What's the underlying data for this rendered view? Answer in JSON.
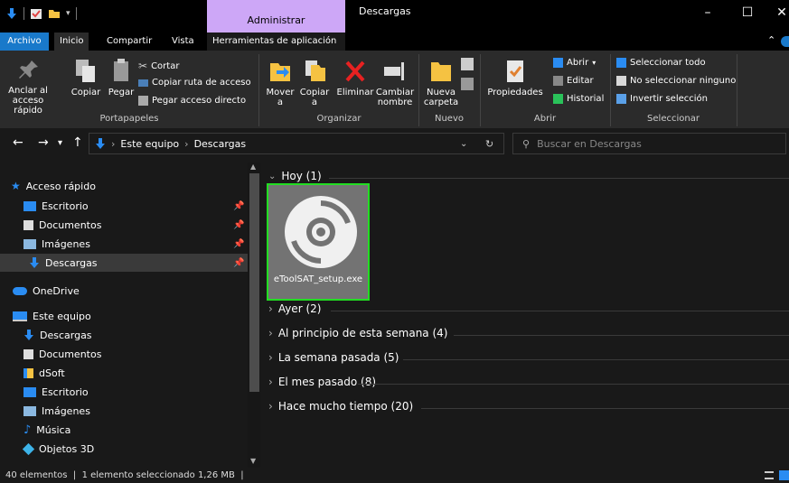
{
  "window": {
    "title": "Descargas",
    "contextual_tab": "Administrar"
  },
  "tabs": [
    "Archivo",
    "Inicio",
    "Compartir",
    "Vista",
    "Herramientas de aplicación"
  ],
  "ribbon": {
    "portapapeles": {
      "label": "Portapapeles",
      "anclar": "Anclar al\nacceso rápido",
      "copiar": "Copiar",
      "pegar": "Pegar",
      "cortar": "Cortar",
      "copiar_ruta": "Copiar ruta de acceso",
      "pegar_acceso": "Pegar acceso directo"
    },
    "organizar": {
      "label": "Organizar",
      "mover": "Mover\na",
      "copiar": "Copiar\na",
      "eliminar": "Eliminar",
      "cambiar": "Cambiar\nnombre"
    },
    "nuevo": {
      "label": "Nuevo",
      "nueva_carpeta": "Nueva\ncarpeta"
    },
    "abrir": {
      "label": "Abrir",
      "propiedades": "Propiedades",
      "abrir": "Abrir",
      "editar": "Editar",
      "historial": "Historial"
    },
    "seleccionar": {
      "label": "Seleccionar",
      "todo": "Seleccionar todo",
      "ninguno": "No seleccionar ninguno",
      "invertir": "Invertir selección"
    }
  },
  "address": {
    "crumbs": [
      "Este equipo",
      "Descargas"
    ],
    "search_placeholder": "Buscar en Descargas"
  },
  "navpane": {
    "quick_access": "Acceso rápido",
    "quick_items": [
      "Escritorio",
      "Documentos",
      "Imágenes",
      "Descargas"
    ],
    "onedrive": "OneDrive",
    "this_pc": "Este equipo",
    "pc_items": [
      "Descargas",
      "Documentos",
      "dSoft",
      "Escritorio",
      "Imágenes",
      "Música",
      "Objetos 3D"
    ]
  },
  "groups": {
    "hoy": "Hoy (1)",
    "ayer": "Ayer (2)",
    "semana": "Al principio de esta semana (4)",
    "pasada": "La semana pasada (5)",
    "mes": "El mes pasado (8)",
    "tiempo": "Hace mucho tiempo (20)"
  },
  "selected_file": {
    "name": "eToolSAT_setup.exe"
  },
  "status": {
    "count": "40 elementos",
    "selection": "1 elemento seleccionado  1,26 MB"
  },
  "colors": {
    "accent": "#1979ca",
    "contextual": "#cda7f7",
    "selection_border": "#22dd22"
  }
}
